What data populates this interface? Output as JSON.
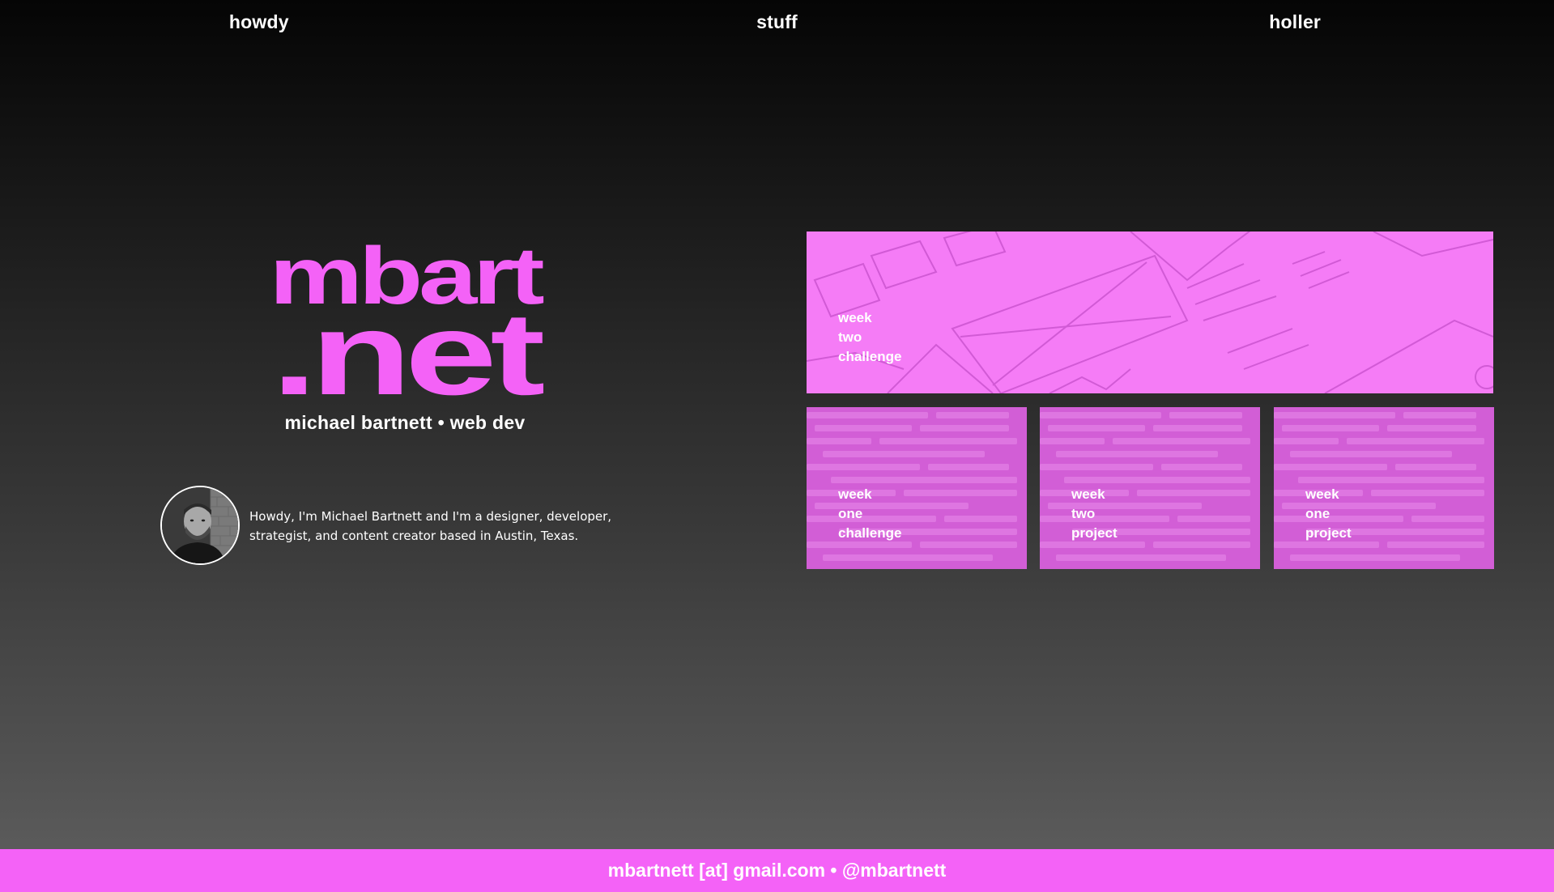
{
  "nav": {
    "items": [
      {
        "label": "howdy"
      },
      {
        "label": "stuff"
      },
      {
        "label": "holler"
      }
    ]
  },
  "logo": {
    "line1": "mbart",
    "line2": ".net",
    "color": "#f462f7"
  },
  "tagline": "michael bartnett • web dev",
  "bio": {
    "text": "Howdy, I'm Michael Bartnett and I'm a designer, developer, strategist, and content creator based in Austin, Texas."
  },
  "projects": {
    "featured": {
      "label_lines": [
        "week",
        "two",
        "challenge"
      ],
      "background": "wireframe-sketch"
    },
    "items": [
      {
        "label_lines": [
          "week",
          "one",
          "challenge"
        ],
        "background": "code"
      },
      {
        "label_lines": [
          "week",
          "two",
          "project"
        ],
        "background": "code"
      },
      {
        "label_lines": [
          "week",
          "one",
          "project"
        ],
        "background": "code"
      }
    ]
  },
  "footer": {
    "text": "mbartnett [at] gmail.com • @mbartnett"
  },
  "colors": {
    "accent": "#f462f7",
    "featured_tile": "#f57cf6",
    "code_tile": "#d25ed6"
  }
}
